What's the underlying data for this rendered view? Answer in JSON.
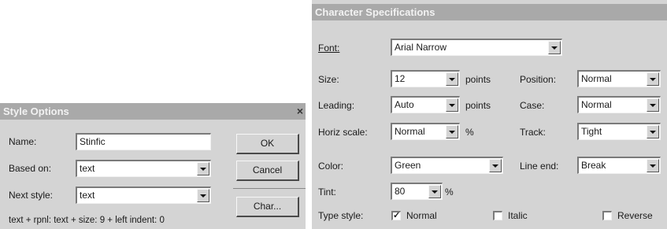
{
  "style_options": {
    "title": "Style Options",
    "close_glyph": "×",
    "name_label": "Name:",
    "name_value": "Stinfic",
    "based_on_label": "Based on:",
    "based_on_value": "text",
    "next_style_label": "Next style:",
    "next_style_value": "text",
    "ok_label": "OK",
    "cancel_label": "Cancel",
    "char_label": "Char...",
    "description": "text + rpnl: text + size: 9 + left indent: 0"
  },
  "char_specs": {
    "title": "Character Specifications",
    "font_label": "Font:",
    "font_value": "Arial Narrow",
    "size_label": "Size:",
    "size_value": "12",
    "size_unit": "points",
    "leading_label": "Leading:",
    "leading_value": "Auto",
    "leading_unit": "points",
    "horiz_scale_label": "Horiz scale:",
    "horiz_scale_value": "Normal",
    "horiz_scale_unit": "%",
    "color_label": "Color:",
    "color_value": "Green",
    "tint_label": "Tint:",
    "tint_value": "80",
    "tint_unit": "%",
    "position_label": "Position:",
    "position_value": "Normal",
    "case_label": "Case:",
    "case_value": "Normal",
    "track_label": "Track:",
    "track_value": "Tight",
    "line_end_label": "Line end:",
    "line_end_value": "Break",
    "type_style_label": "Type style:",
    "opt_normal": "Normal",
    "opt_italic": "Italic",
    "opt_reverse": "Reverse",
    "normal_checked": true,
    "italic_checked": false,
    "reverse_checked": false
  }
}
